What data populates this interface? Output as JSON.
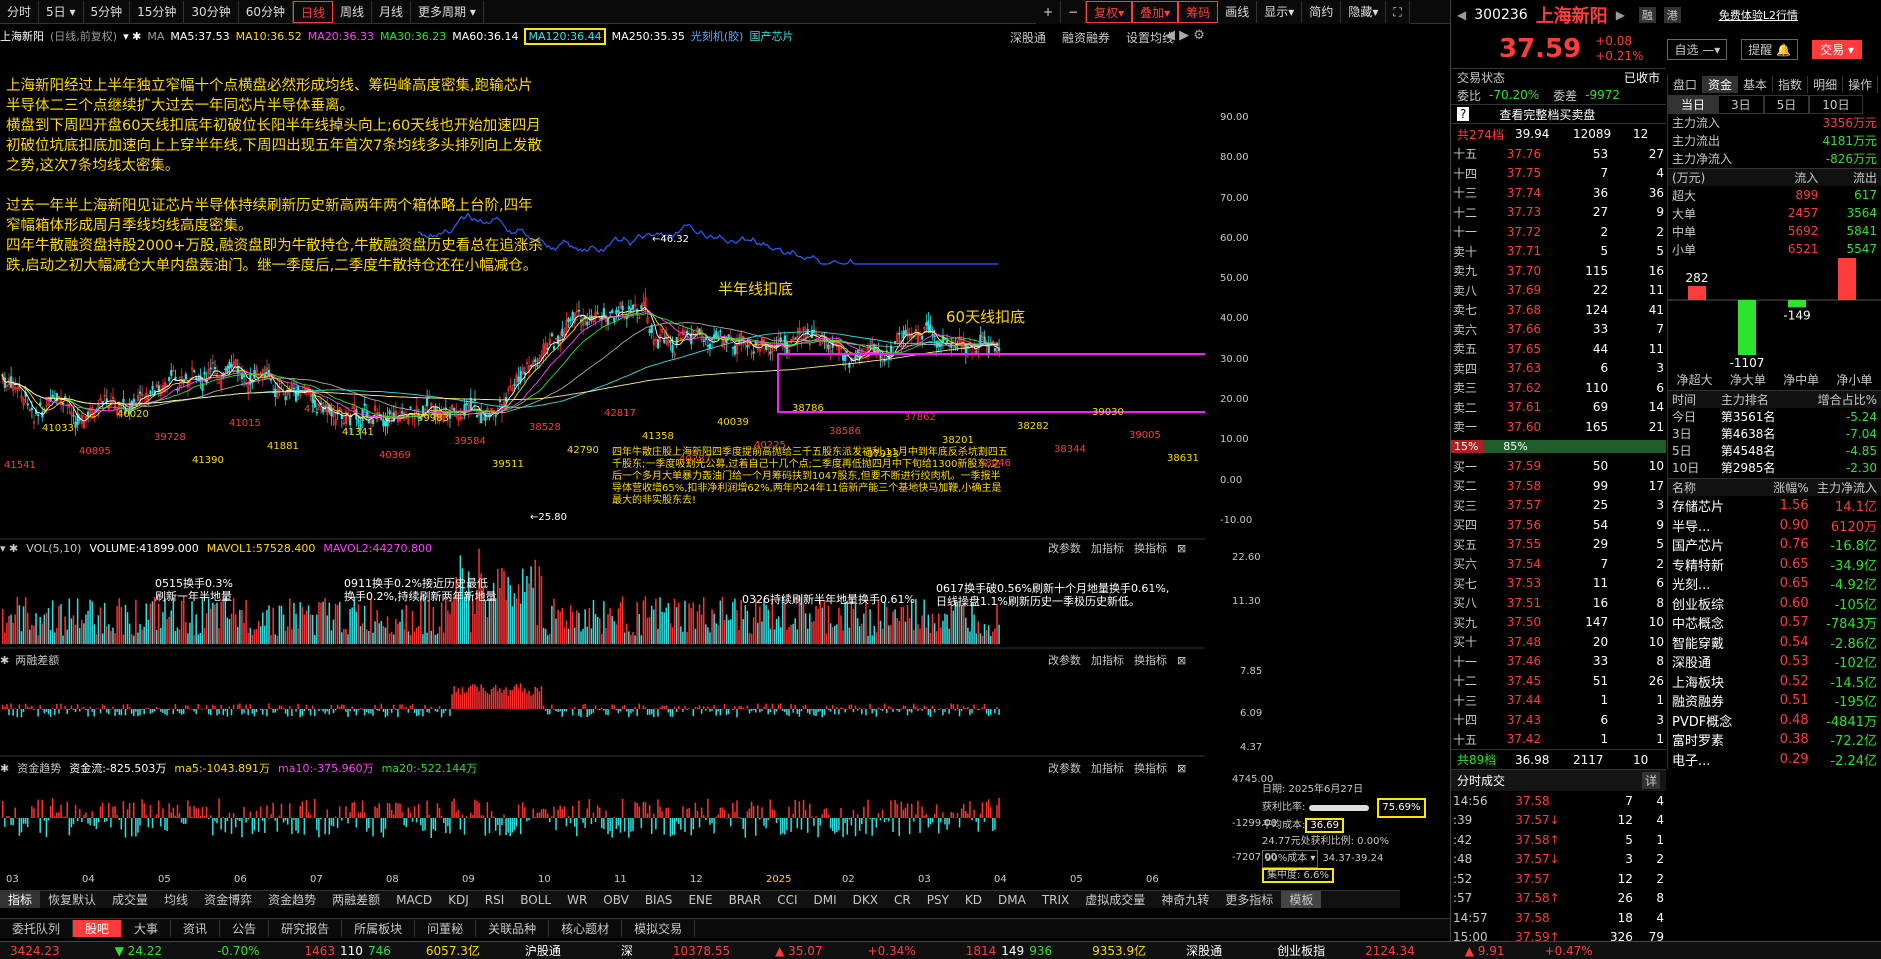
{
  "toolbar": {
    "periods": [
      "分时",
      "5日",
      "5分钟",
      "15分钟",
      "30分钟",
      "60分钟",
      "日线",
      "周线",
      "月线",
      "更多周期"
    ],
    "selected": "日线",
    "right_buttons": [
      "复权",
      "叠加",
      "筹码",
      "画线",
      "显示",
      "简约",
      "隐藏"
    ]
  },
  "ma_line": {
    "stock": "上海新阳",
    "mode": "(日线,前复权)",
    "ma_label": "MA",
    "ma5": "MA5:37.53",
    "ma10": "MA10:36.52",
    "ma20": "MA20:36.33",
    "ma30": "MA30:36.23",
    "ma60": "MA60:36.14",
    "ma120": "MA120:36.44",
    "ma250": "MA250:35.35",
    "concept1": "光刻机(胶)",
    "concept2": "国产芯片",
    "right": [
      "深股通",
      "融资融券",
      "设置均线"
    ]
  },
  "annotations": {
    "p1": "上海新阳经过上半年独立窄幅十个点横盘必然形成均线、筹码峰高度密集,跑输芯片半导体二三个点继续扩大过去一年同芯片半导体垂离。",
    "p2": "横盘到下周四开盘60天线扣底年初破位长阳半年线掉头向上;60天线也开始加速四月初破位坑底扣底加速向上上穿半年线,下周四出现五年首次7条均线多头排列向上发散之势,这次7条均线太密集。",
    "p3": "过去一年半上海新阳见证芯片半导体持续刷新历史新高两年两个箱体略上台阶,四年窄幅箱体形成周月季线均线高度密集。",
    "p4": "四年牛散融资盘持股2000+万股,融资盘即为牛散持仓,牛散融资盘历史看总在追涨杀跌,启动之初大幅减仓大单内盘轰油门。继一季度后,二季度牛散持仓还在小幅减仓。",
    "half_year": "半年线扣底",
    "sixty_day": "60天线扣底",
    "bottom_note": "四年牛散庄股上海新阳四季度提前高抛给三千五股东派发福利,11月中到年底反杀坑割四五千股东;一季度吸割光公募,过着自己十几个点;二季度再低抛四月中下旬给1300新股东,之后一个多月大单暴力轰油门给一个月筹码扶到1047股东,但要不断进行绞肉机。一季报半导体营收增65%,扣非净利润增62%,两年内24年11倍新产能三个基地快马加鞭,小确主是最大的非实股东去!",
    "peak1": "46.32",
    "low1": "25.80"
  },
  "price_axis": [
    "90.00",
    "80.00",
    "70.00",
    "60.00",
    "50.00",
    "40.00",
    "30.00",
    "20.00",
    "10.00",
    "0.00",
    "-10.00"
  ],
  "chip_labels": [
    "41541",
    "41033",
    "40895",
    "40020",
    "39728",
    "41390",
    "41015",
    "41881",
    "41413",
    "41341",
    "40369",
    "39983",
    "39584",
    "39511",
    "38528",
    "42790",
    "42817",
    "41358",
    "40287",
    "40039",
    "40225",
    "38786",
    "38586",
    "37933",
    "37862",
    "38201",
    "38046",
    "38282",
    "38344",
    "39030",
    "39005",
    "38631"
  ],
  "vol": {
    "hdr1": "VOL(5,10)",
    "hdr2": "VOLUME:41899.000",
    "hdr3": "MAVOL1:57528.400",
    "hdr4": "MAVOL2:44270.800",
    "axis": [
      "22.60",
      "11.30"
    ],
    "n1": "0515换手0.3%",
    "n1b": "刷新一年半地量",
    "n2": "0911换手0.2%接近历史最低",
    "n2b": "换手0.2%,持续刷新两年新地量",
    "n3": "0326持续刷新半年地量换手0.61%",
    "n4": "0617换手破0.56%刷新十个月地量换手0.61%,",
    "n4b": "日线操盘1.1%刷新历史一季极历史新低。"
  },
  "panel_btns": [
    "改参数",
    "加指标",
    "换指标"
  ],
  "p3": {
    "title": "两融差额",
    "axis": [
      "7.85",
      "6.09",
      "4.37"
    ]
  },
  "p4": {
    "title": "资金趋势",
    "h1": "资金流:-825.503万",
    "h2": "ma5:-1043.891万",
    "h3": "ma10:-375.960万",
    "h4": "ma20:-522.144万",
    "axis": [
      "4745.00",
      "-1299.00",
      "-7207.00"
    ]
  },
  "chipinfo": {
    "date": "日期: 2025年6月27日",
    "profit": "获利比率:",
    "profit_v": "75.69%",
    "avg": "平均成本:",
    "avg_v": "36.69",
    "nets": "24.77元处获利比例: 0.00%",
    "cost": "90%成本",
    "cost_v": "34.37-39.24",
    "conc": "集中度: 6.6%"
  },
  "xaxis": [
    "03",
    "04",
    "05",
    "06",
    "07",
    "08",
    "09",
    "10",
    "11",
    "12",
    "2025",
    "02",
    "03",
    "04",
    "05",
    "06"
  ],
  "bottom_tabs": [
    "指标",
    "恢复默认",
    "成交量",
    "均线",
    "资金博弈",
    "资金趋势",
    "两融差额",
    "MACD",
    "KDJ",
    "RSI",
    "BOLL",
    "WR",
    "OBV",
    "BIAS",
    "ENE",
    "BRAR",
    "CCI",
    "DMI",
    "DKX",
    "CR",
    "PSY",
    "KD",
    "DMA",
    "TRIX",
    "虚拟成交量",
    "神奇九转",
    "更多指标",
    "模板"
  ],
  "info_tabs": [
    "委托队列",
    "股吧",
    "大事",
    "资讯",
    "公告",
    "研究报告",
    "所属板块",
    "问董秘",
    "关联品种",
    "核心题材",
    "模拟交易"
  ],
  "status": {
    "sh": "3424.23",
    "sh_chg": "▼ 24.22",
    "sh_pct": "-0.70%",
    "sh_n": "1463",
    "sh_m": "110",
    "sh_u": "746",
    "sh_amt": "6057.3亿",
    "hgt": "沪股通",
    "sz_label": "深",
    "sz": "10378.55",
    "sz_chg": "▲ 35.07",
    "sz_pct": "+0.34%",
    "sz_n": "1814",
    "sz_m": "149",
    "sz_u": "936",
    "sz_amt": "9353.9亿",
    "sgt": "深股通",
    "cyb": "创业板指",
    "cyb_v": "2124.34",
    "cyb_chg": "▲ 9.91",
    "cyb_pct": "+0.47%"
  },
  "quote": {
    "code": "300236",
    "name": "上海新阳",
    "rong": "融",
    "gang": "港",
    "l2": "免费体验L2行情",
    "price": "37.59",
    "chg": "+0.08",
    "pct": "+0.21%",
    "zixuan": "自选",
    "tixing": "提醒",
    "jiaoyi": "交易",
    "state": "交易状态",
    "state_v": "已收市",
    "wb": "委比",
    "wb_v": "-70.20%",
    "wc": "委差",
    "wc_v": "-9972",
    "full": "查看完整档买卖盘",
    "top_tot": "共274档",
    "top_p": "39.94",
    "top_v": "12089",
    "top_n": "12",
    "bot_tot": "共89档",
    "bot_p": "36.98",
    "bot_v": "2117",
    "bot_n": "10",
    "bar_l": "15%",
    "bar_r": "85%"
  },
  "asks": [
    [
      "十五",
      "37.76",
      "53",
      "27"
    ],
    [
      "十四",
      "37.75",
      "7",
      "4"
    ],
    [
      "十三",
      "37.74",
      "36",
      "36"
    ],
    [
      "十二",
      "37.73",
      "27",
      "9"
    ],
    [
      "十一",
      "37.72",
      "2",
      "2"
    ],
    [
      "卖十",
      "37.71",
      "5",
      "5"
    ],
    [
      "卖九",
      "37.70",
      "115",
      "16"
    ],
    [
      "卖八",
      "37.69",
      "22",
      "11"
    ],
    [
      "卖七",
      "37.68",
      "124",
      "41"
    ],
    [
      "卖六",
      "37.66",
      "33",
      "7"
    ],
    [
      "卖五",
      "37.65",
      "44",
      "11"
    ],
    [
      "卖四",
      "37.63",
      "6",
      "3"
    ],
    [
      "卖三",
      "37.62",
      "110",
      "6"
    ],
    [
      "卖二",
      "37.61",
      "69",
      "14"
    ],
    [
      "卖一",
      "37.60",
      "165",
      "21"
    ]
  ],
  "bids": [
    [
      "买一",
      "37.59",
      "50",
      "10"
    ],
    [
      "买二",
      "37.58",
      "99",
      "17"
    ],
    [
      "买三",
      "37.57",
      "25",
      "3"
    ],
    [
      "买四",
      "37.56",
      "54",
      "9"
    ],
    [
      "买五",
      "37.55",
      "29",
      "5"
    ],
    [
      "买六",
      "37.54",
      "7",
      "2"
    ],
    [
      "买七",
      "37.53",
      "11",
      "6"
    ],
    [
      "买八",
      "37.51",
      "16",
      "8"
    ],
    [
      "买九",
      "37.50",
      "147",
      "10"
    ],
    [
      "买十",
      "37.48",
      "20",
      "10"
    ],
    [
      "十一",
      "37.46",
      "33",
      "8"
    ],
    [
      "十二",
      "37.45",
      "51",
      "26"
    ],
    [
      "十三",
      "37.44",
      "1",
      "1"
    ],
    [
      "十四",
      "37.43",
      "6",
      "3"
    ],
    [
      "十五",
      "37.42",
      "1",
      "1"
    ]
  ],
  "fund": {
    "tabs": [
      "盘口",
      "资金",
      "基本",
      "指数",
      "明细",
      "操作"
    ],
    "sel": "资金",
    "days": [
      "当日",
      "3日",
      "5日",
      "10日"
    ],
    "in_l": "主力流入",
    "in_v": "3356万元",
    "out_l": "主力流出",
    "out_v": "4181万元",
    "net_l": "主力净流入",
    "net_v": "-826万元",
    "unit": "(万元)",
    "h_in": "流入",
    "h_out": "流出",
    "rows": [
      [
        "超大",
        "899",
        "617"
      ],
      [
        "大单",
        "2457",
        "3564"
      ],
      [
        "中单",
        "5692",
        "5841"
      ],
      [
        "小单",
        "6521",
        "5547"
      ]
    ],
    "bar_vals": [
      "282",
      "-1107",
      "-149",
      "975"
    ],
    "bar_labels": [
      "净超大",
      "净大单",
      "净中单",
      "净小单"
    ],
    "rank_h": [
      "时间",
      "主力排名",
      "增合占比%"
    ],
    "ranks": [
      [
        "今日",
        "第3561名",
        "-5.24"
      ],
      [
        "3日",
        "第4638名",
        "-7.04"
      ],
      [
        "5日",
        "第4548名",
        "-4.85"
      ],
      [
        "10日",
        "第2985名",
        "-2.30"
      ]
    ],
    "sec_h": [
      "名称",
      "涨幅%",
      "主力净流入"
    ],
    "sectors": [
      [
        "存储芯片",
        "1.56",
        "14.1亿"
      ],
      [
        "半导...",
        "0.90",
        "6120万"
      ],
      [
        "国产芯片",
        "0.76",
        "-16.8亿"
      ],
      [
        "专精特新",
        "0.65",
        "-34.9亿"
      ],
      [
        "光刻...",
        "0.65",
        "-4.92亿"
      ],
      [
        "创业板综",
        "0.60",
        "-105亿"
      ],
      [
        "中芯概念",
        "0.57",
        "-7843万"
      ],
      [
        "智能穿戴",
        "0.54",
        "-2.86亿"
      ],
      [
        "深股通",
        "0.53",
        "-102亿"
      ],
      [
        "上海板块",
        "0.52",
        "-14.5亿"
      ],
      [
        "融资融券",
        "0.51",
        "-195亿"
      ],
      [
        "PVDF概念",
        "0.48",
        "-4841万"
      ],
      [
        "富时罗素",
        "0.38",
        "-72.2亿"
      ],
      [
        "电子...",
        "0.29",
        "-2.24亿"
      ]
    ]
  },
  "ticks": {
    "title": "分时成交",
    "btn": "详",
    "rows": [
      [
        "14:56",
        "37.58",
        "7",
        "4"
      ],
      [
        ":39",
        "37.57↓",
        "12",
        "4"
      ],
      [
        ":42",
        "37.58↑",
        "5",
        "1"
      ],
      [
        ":48",
        "37.57↓",
        "3",
        "2"
      ],
      [
        ":52",
        "37.57",
        "12",
        "2"
      ],
      [
        ":57",
        "37.58↑",
        "26",
        "8"
      ],
      [
        "14:57",
        "37.58",
        "18",
        "4"
      ],
      [
        "15:00",
        "37.59↑",
        "326",
        "79"
      ]
    ]
  }
}
